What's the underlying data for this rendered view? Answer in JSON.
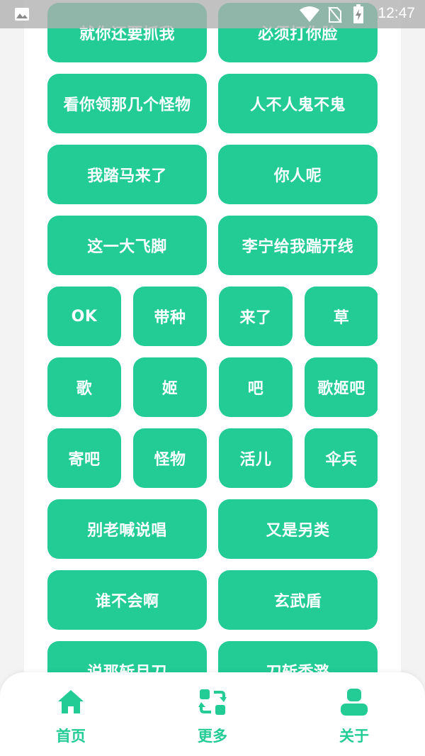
{
  "status_bar": {
    "time": "12:47",
    "icons": [
      "gallery-icon",
      "wifi-icon",
      "no-sim-icon",
      "battery-charging-icon"
    ]
  },
  "buttons": [
    [
      "就你还要抓我",
      "必须打你脸"
    ],
    [
      "看你领那几个怪物",
      "人不人鬼不鬼"
    ],
    [
      "我踏马来了",
      "你人呢"
    ],
    [
      "这一大飞脚",
      "李宁给我踹开线"
    ],
    [
      "OK",
      "带种",
      "来了",
      "草"
    ],
    [
      "歌",
      "姬",
      "吧",
      "歌姬吧"
    ],
    [
      "寄吧",
      "怪物",
      "活儿",
      "伞兵"
    ],
    [
      "别老喊说唱",
      "又是另类"
    ],
    [
      "谁不会啊",
      "玄武盾"
    ],
    [
      "说那斩月刀",
      "刀斩秃潞"
    ]
  ],
  "nav": {
    "home": "首页",
    "more": "更多",
    "about": "关于"
  },
  "colors": {
    "accent": "#23cc95",
    "card": "#ffffff",
    "background": "#f2f3f2"
  }
}
